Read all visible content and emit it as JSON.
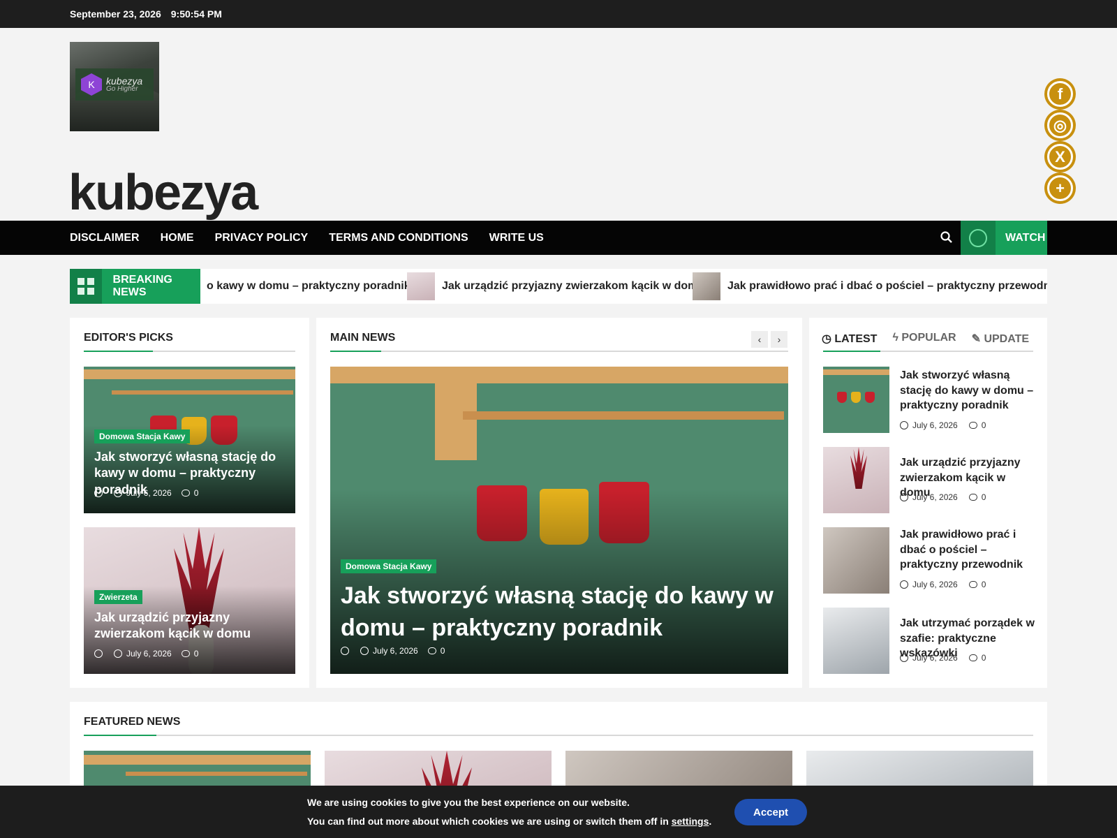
{
  "topbar": {
    "date": "September 23, 2026",
    "time": "9:50:54 PM"
  },
  "header": {
    "site_title": "kubezya",
    "logo_name": "kubezya",
    "logo_tagline": "Go Higher",
    "logo_letter": "K"
  },
  "social": [
    {
      "name": "facebook-icon",
      "glyph": "f"
    },
    {
      "name": "instagram-icon",
      "glyph": "◎"
    },
    {
      "name": "x-icon",
      "glyph": "X"
    },
    {
      "name": "plus-icon",
      "glyph": "+"
    }
  ],
  "nav": {
    "items": [
      "DISCLAIMER",
      "HOME",
      "PRIVACY POLICY",
      "TERMS AND CONDITIONS",
      "WRITE US"
    ],
    "watch_label": "WATCH"
  },
  "breaking": {
    "label": "BREAKING NEWS",
    "items": [
      "o kawy w domu – praktyczny poradnik",
      "Jak urządzić przyjazny zwierzakom kącik w domu",
      "Jak prawidłowo prać i dbać o pościel – praktyczny przewodnik"
    ]
  },
  "editors": {
    "title": "EDITOR'S PICKS",
    "cards": [
      {
        "tag": "Domowa Stacja Kawy",
        "title": "Jak stworzyć własną stację do kawy w domu – praktyczny poradnik",
        "date": "July 6, 2026",
        "comments": "0"
      },
      {
        "tag": "Zwierzeta",
        "title": "Jak urządzić przyjazny zwierzakom kącik w domu",
        "date": "July 6, 2026",
        "comments": "0"
      }
    ]
  },
  "main_news": {
    "title": "MAIN NEWS",
    "card": {
      "tag": "Domowa Stacja Kawy",
      "title": "Jak stworzyć własną stację do kawy w domu – praktyczny poradnik",
      "date": "July 6, 2026",
      "comments": "0"
    }
  },
  "sidebar": {
    "tabs": [
      "LATEST",
      "POPULAR",
      "UPDATE"
    ],
    "items": [
      {
        "title": "Jak stworzyć własną stację do kawy w domu – praktyczny poradnik",
        "date": "July 6, 2026",
        "comments": "0"
      },
      {
        "title": "Jak urządzić przyjazny zwierzakom kącik w domu",
        "date": "July 6, 2026",
        "comments": "0"
      },
      {
        "title": "Jak prawidłowo prać i dbać o pościel – praktyczny przewodnik",
        "date": "July 6, 2026",
        "comments": "0"
      },
      {
        "title": "Jak utrzymać porządek w szafie: praktyczne wskazówki",
        "date": "July 6, 2026",
        "comments": "0"
      }
    ]
  },
  "featured": {
    "title": "FEATURED NEWS"
  },
  "cookie": {
    "line1": "We are using cookies to give you the best experience on our website.",
    "line2_prefix": "You can find out more about which cookies we are using or switch them off in ",
    "line2_link": "settings",
    "line2_suffix": ".",
    "accept_label": "Accept"
  },
  "colors": {
    "accent": "#17a05a",
    "social": "#c8900f",
    "nav_bg": "#050505",
    "accept": "#1f4fb0"
  }
}
